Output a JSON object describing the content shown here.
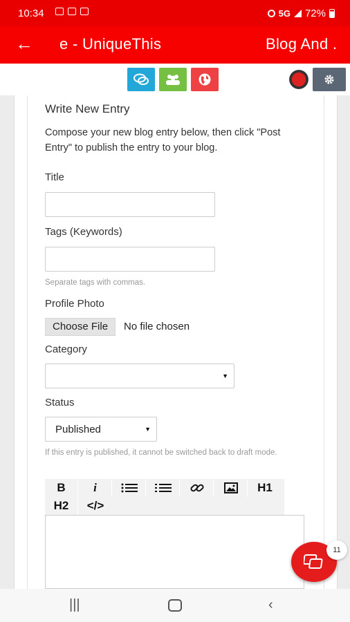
{
  "status_bar": {
    "time": "10:34",
    "network": "5G",
    "battery": "72%"
  },
  "app_bar": {
    "title": "e - UniqueThis",
    "title_right": "Blog And ."
  },
  "toolbar": {
    "icons": [
      "chat-icon",
      "users-icon",
      "globe-icon",
      "profile-logo",
      "gear-icon"
    ],
    "colors": {
      "chat": "#22a7d8",
      "users": "#75c043",
      "globe": "#ee4144",
      "gear": "#5b6774"
    }
  },
  "form": {
    "heading": "Write New Entry",
    "intro": "Compose your new blog entry below, then click \"Post Entry\" to publish the entry to your blog.",
    "title_label": "Title",
    "title_value": "",
    "tags_label": "Tags (Keywords)",
    "tags_value": "",
    "tags_hint": "Separate tags with commas.",
    "photo_label": "Profile Photo",
    "choose_file": "Choose File",
    "no_file": "No file chosen",
    "category_label": "Category",
    "category_value": "",
    "status_label": "Status",
    "status_value": "Published",
    "status_hint": "If this entry is published, it cannot be switched back to draft mode."
  },
  "editor": {
    "buttons": [
      "B",
      "i",
      "H1",
      "H2",
      "</>"
    ],
    "body": ""
  },
  "fab": {
    "badge": "11"
  },
  "brand_color": "#f60000"
}
